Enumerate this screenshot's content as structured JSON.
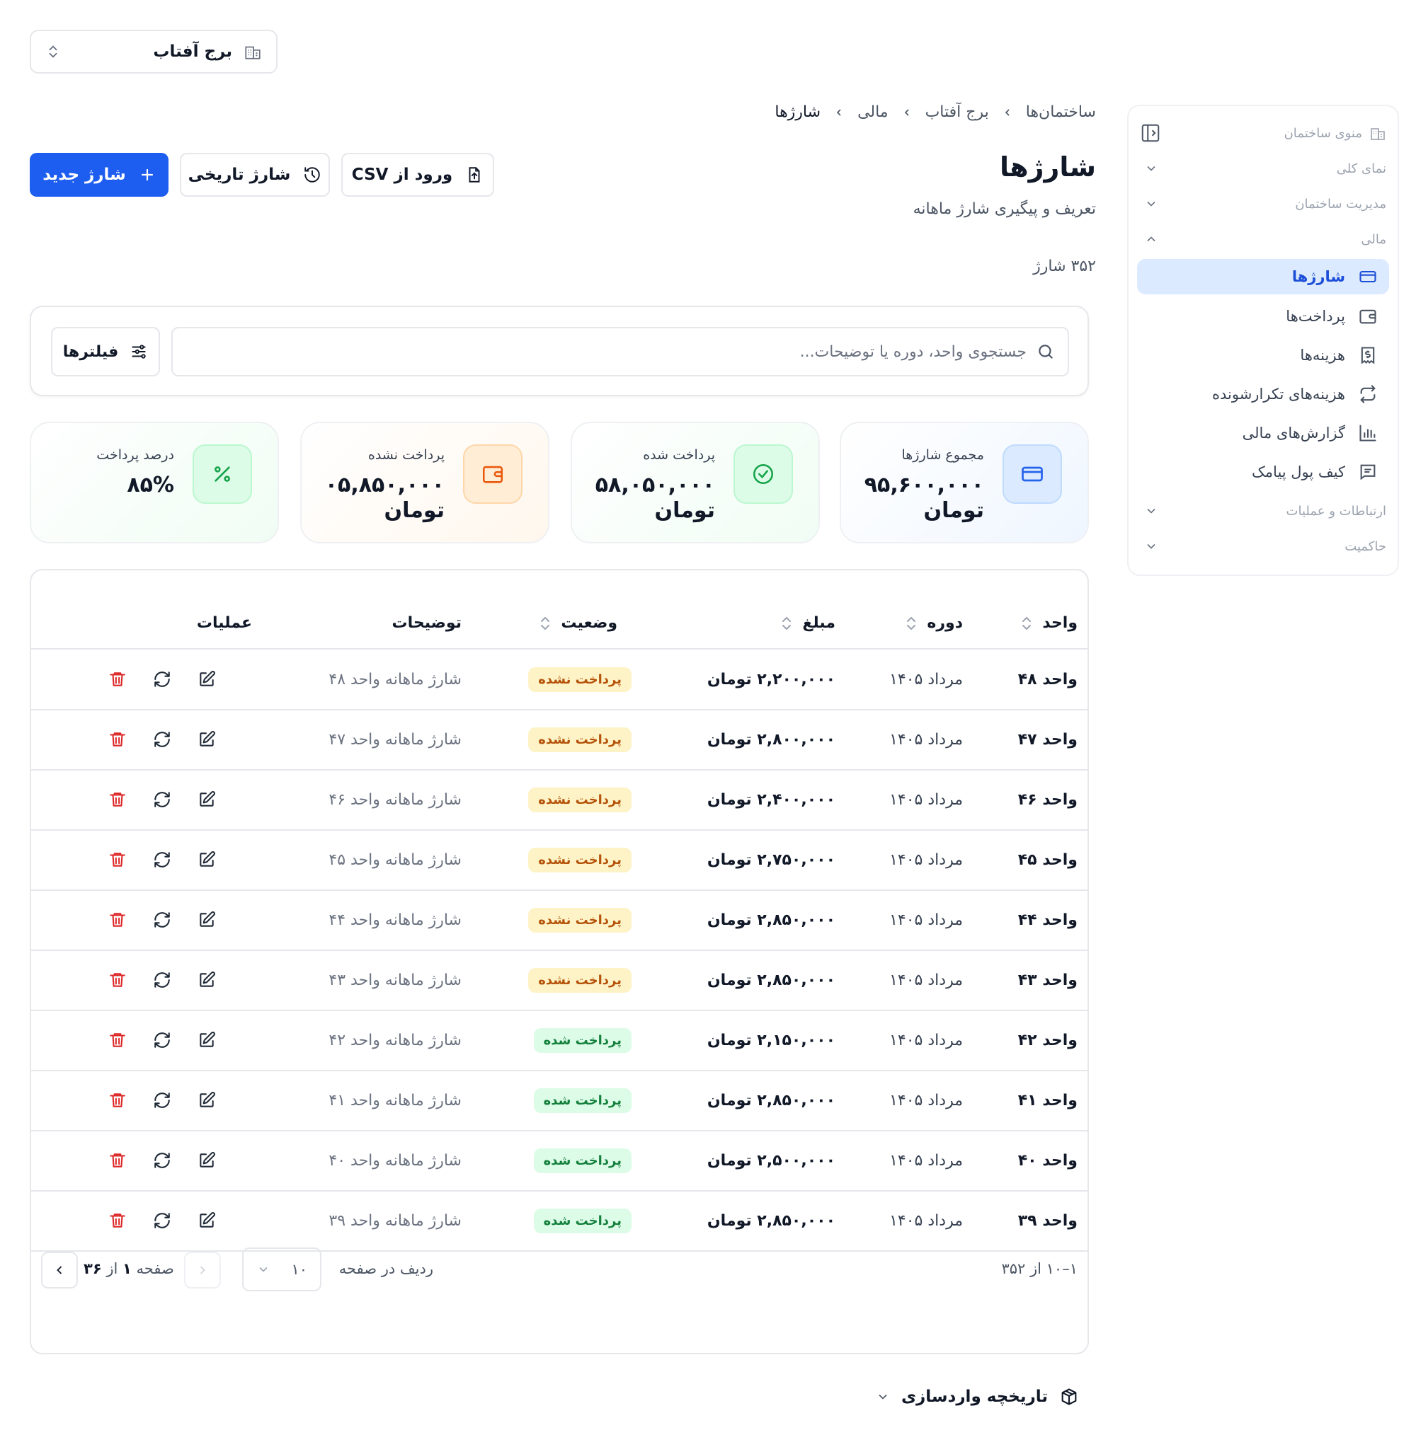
{
  "building_selector": {
    "name": "برج آفتاب"
  },
  "sidebar": {
    "title": "منوی ساختمان",
    "sections": [
      {
        "label": "نمای کلی",
        "expanded": false
      },
      {
        "label": "مدیریت ساختمان",
        "expanded": false
      },
      {
        "label": "مالی",
        "expanded": true
      }
    ],
    "finance_items": [
      {
        "label": "شارژها",
        "icon": "card-icon",
        "active": true
      },
      {
        "label": "پرداخت‌ها",
        "icon": "wallet-icon",
        "active": false
      },
      {
        "label": "هزینه‌ها",
        "icon": "receipt-dollar-icon",
        "active": false
      },
      {
        "label": "هزینه‌های تکرارشونده",
        "icon": "repeat-icon",
        "active": false
      },
      {
        "label": "گزارش‌های مالی",
        "icon": "bar-chart-icon",
        "active": false
      },
      {
        "label": "کیف پول پیامک",
        "icon": "message-icon",
        "active": false
      }
    ],
    "bottom_sections": [
      {
        "label": "ارتباطات و عملیات",
        "expanded": false
      },
      {
        "label": "حاکمیت",
        "expanded": false
      }
    ]
  },
  "breadcrumb": [
    "ساختمان‌ها",
    "برج آفتاب",
    "مالی",
    "شارژها"
  ],
  "page": {
    "title": "شارژها",
    "subtitle": "تعریف و پیگیری شارژ ماهانه",
    "count": "۳۵۲ شارژ"
  },
  "header_buttons": {
    "import_csv": "ورود از CSV",
    "historical": "شارژ تاریخی",
    "new_charge": "شارژ جدید"
  },
  "search": {
    "placeholder": "جستجوی واحد، دوره یا توضیحات...",
    "value": "",
    "filters_label": "فیلترها"
  },
  "stats": [
    {
      "label": "مجموع شارژها",
      "value": "۹۵,۶۰۰,۰۰۰",
      "unit": "تومان",
      "icon": "card-icon",
      "accent": "#2563eb"
    },
    {
      "label": "پرداخت شده",
      "value": "۵۸,۰۵۰,۰۰۰",
      "unit": "تومان",
      "icon": "check-circle-icon",
      "accent": "#16a34a"
    },
    {
      "label": "پرداخت نشده",
      "value": "۰۵,۸۵۰,۰۰۰",
      "unit": "تومان",
      "icon": "wallet-icon",
      "accent": "#ea580c"
    },
    {
      "label": "درصد پرداخت",
      "value": "۸۵%",
      "unit": "",
      "icon": "percent-icon",
      "accent": "#16a34a"
    }
  ],
  "table": {
    "columns": {
      "unit": "واحد",
      "period": "دوره",
      "amount": "مبلغ",
      "status": "وضعیت",
      "description": "توضیحات",
      "actions": "عملیات"
    },
    "rows": [
      {
        "unit": "واحد ۴۸",
        "period": "مرداد ۱۴۰۵",
        "amount": "۲,۲۰۰,۰۰۰ تومان",
        "status": "پرداخت نشده",
        "status_type": "unpaid",
        "description": "شارژ ماهانه واحد ۴۸"
      },
      {
        "unit": "واحد ۴۷",
        "period": "مرداد ۱۴۰۵",
        "amount": "۲,۸۰۰,۰۰۰ تومان",
        "status": "پرداخت نشده",
        "status_type": "unpaid",
        "description": "شارژ ماهانه واحد ۴۷"
      },
      {
        "unit": "واحد ۴۶",
        "period": "مرداد ۱۴۰۵",
        "amount": "۲,۴۰۰,۰۰۰ تومان",
        "status": "پرداخت نشده",
        "status_type": "unpaid",
        "description": "شارژ ماهانه واحد ۴۶"
      },
      {
        "unit": "واحد ۴۵",
        "period": "مرداد ۱۴۰۵",
        "amount": "۲,۷۵۰,۰۰۰ تومان",
        "status": "پرداخت نشده",
        "status_type": "unpaid",
        "description": "شارژ ماهانه واحد ۴۵"
      },
      {
        "unit": "واحد ۴۴",
        "period": "مرداد ۱۴۰۵",
        "amount": "۲,۸۵۰,۰۰۰ تومان",
        "status": "پرداخت نشده",
        "status_type": "unpaid",
        "description": "شارژ ماهانه واحد ۴۴"
      },
      {
        "unit": "واحد ۴۳",
        "period": "مرداد ۱۴۰۵",
        "amount": "۲,۸۵۰,۰۰۰ تومان",
        "status": "پرداخت نشده",
        "status_type": "unpaid",
        "description": "شارژ ماهانه واحد ۴۳"
      },
      {
        "unit": "واحد ۴۲",
        "period": "مرداد ۱۴۰۵",
        "amount": "۲,۱۵۰,۰۰۰ تومان",
        "status": "پرداخت شده",
        "status_type": "paid",
        "description": "شارژ ماهانه واحد ۴۲"
      },
      {
        "unit": "واحد ۴۱",
        "period": "مرداد ۱۴۰۵",
        "amount": "۲,۸۵۰,۰۰۰ تومان",
        "status": "پرداخت شده",
        "status_type": "paid",
        "description": "شارژ ماهانه واحد ۴۱"
      },
      {
        "unit": "واحد ۴۰",
        "period": "مرداد ۱۴۰۵",
        "amount": "۲,۵۰۰,۰۰۰ تومان",
        "status": "پرداخت شده",
        "status_type": "paid",
        "description": "شارژ ماهانه واحد ۴۰"
      },
      {
        "unit": "واحد ۳۹",
        "period": "مرداد ۱۴۰۵",
        "amount": "۲,۸۵۰,۰۰۰ تومان",
        "status": "پرداخت شده",
        "status_type": "paid",
        "description": "شارژ ماهانه واحد ۳۹"
      }
    ]
  },
  "pagination": {
    "range": "۱–۱۰ از ۳۵۲",
    "rows_per_page_label": "ردیف در صفحه",
    "rows_per_page": "۱۰",
    "page_prefix": "صفحه",
    "current_page": "۱",
    "of": "از",
    "total_pages": "۳۶"
  },
  "import_history": {
    "label": "تاریخچه واردسازی"
  },
  "colors": {
    "primary": "#1d5ef0",
    "active_nav_bg": "#dbeafe",
    "unpaid_badge_bg": "#fef3c7",
    "unpaid_badge_text": "#b45309",
    "paid_badge_bg": "#dcfce7",
    "paid_badge_text": "#15803d",
    "delete": "#dc2626"
  }
}
